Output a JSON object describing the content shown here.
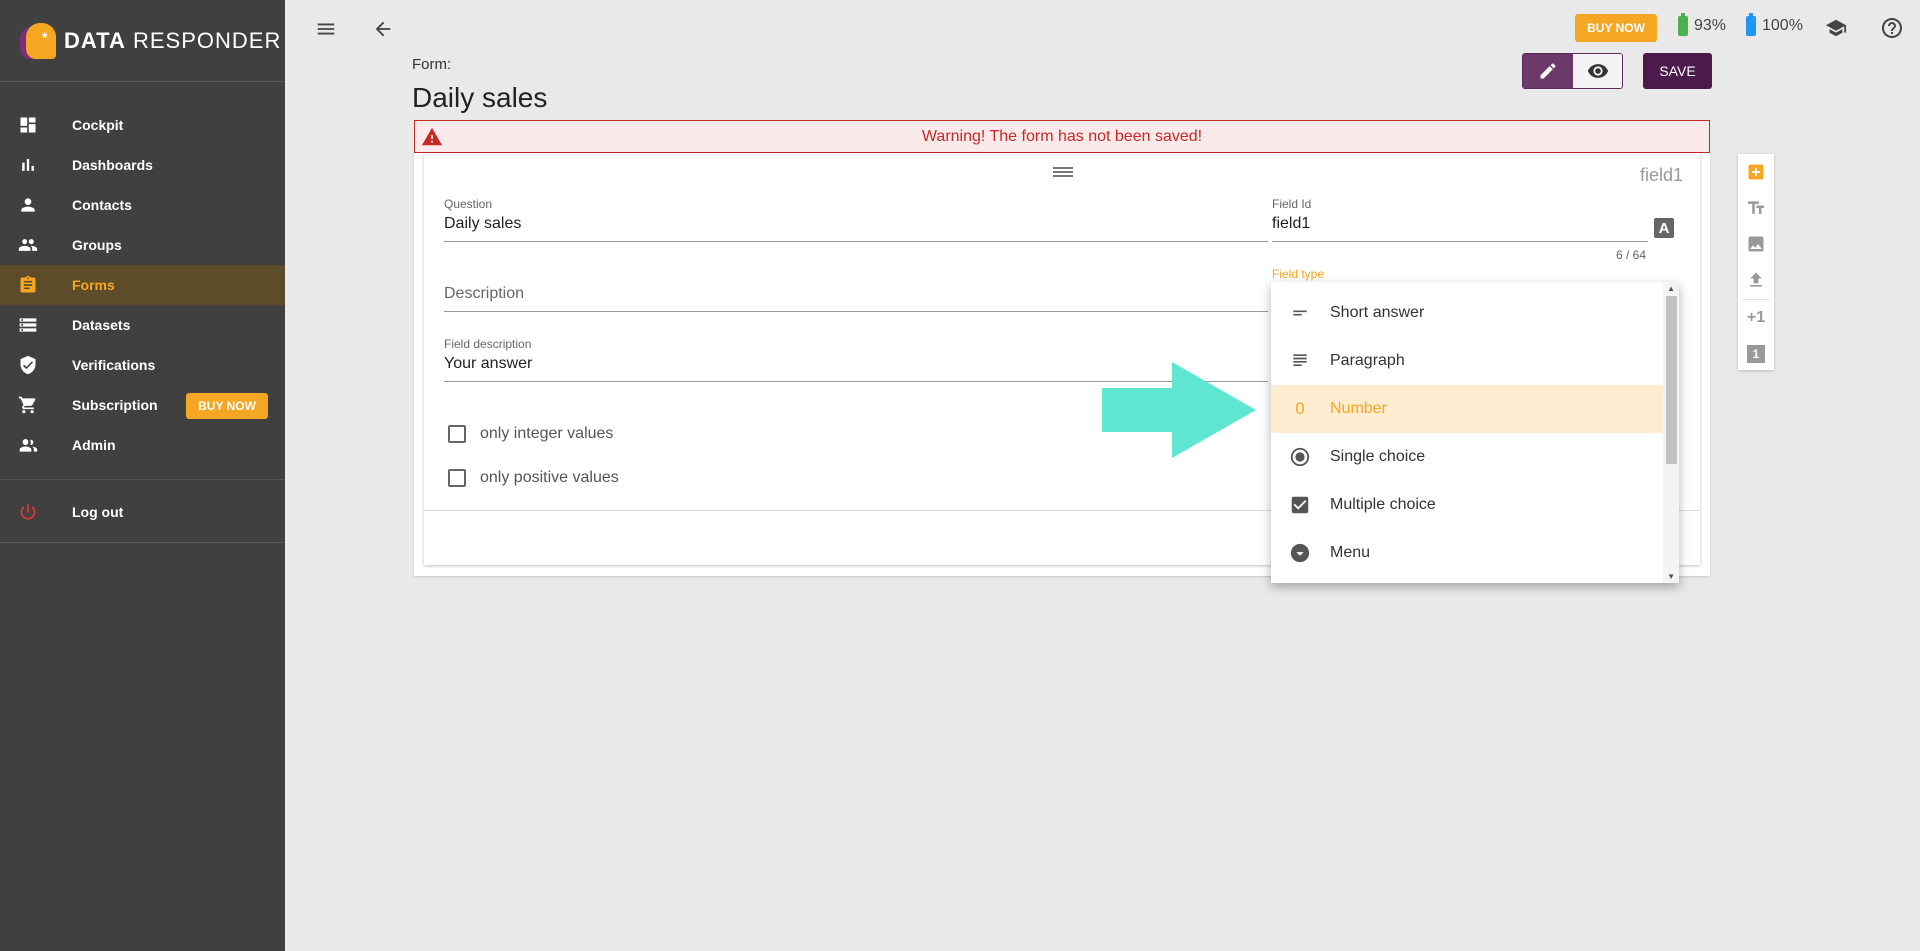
{
  "app": {
    "logo_bold": "DATA",
    "logo_rest": "RESPONDER"
  },
  "sidebar": {
    "items": [
      {
        "label": "Cockpit",
        "icon": "dashboard-icon"
      },
      {
        "label": "Dashboards",
        "icon": "bar-chart-icon"
      },
      {
        "label": "Contacts",
        "icon": "person-icon"
      },
      {
        "label": "Groups",
        "icon": "people-icon"
      },
      {
        "label": "Forms",
        "icon": "clipboard-icon",
        "active": true
      },
      {
        "label": "Datasets",
        "icon": "list-icon"
      },
      {
        "label": "Verifications",
        "icon": "shield-check-icon"
      },
      {
        "label": "Subscription",
        "icon": "cart-icon"
      },
      {
        "label": "Admin",
        "icon": "admin-people-icon"
      }
    ],
    "buy_now": "BUY NOW",
    "logout": "Log out"
  },
  "topbar": {
    "buy_now": "BUY NOW",
    "battery_green": "93%",
    "battery_blue": "100%"
  },
  "form": {
    "label": "Form:",
    "title": "Daily sales",
    "save": "SAVE",
    "warning": "Warning! The form has not been saved!"
  },
  "field": {
    "tag": "field1",
    "question_label": "Question",
    "question_value": "Daily sales",
    "field_id_label": "Field Id",
    "field_id_value": "field1",
    "counter": "6 / 64",
    "description_placeholder": "Description",
    "field_desc_label": "Field description",
    "field_desc_value": "Your answer",
    "field_type_label": "Field type",
    "check_integer": "only integer values",
    "check_positive": "only positive values"
  },
  "dropdown": {
    "options": [
      {
        "label": "Short answer",
        "icon": "short-text-icon"
      },
      {
        "label": "Paragraph",
        "icon": "paragraph-icon"
      },
      {
        "label": "Number",
        "icon": "number-icon",
        "glyph": "0",
        "selected": true
      },
      {
        "label": "Single choice",
        "icon": "radio-icon"
      },
      {
        "label": "Multiple choice",
        "icon": "checkbox-icon"
      },
      {
        "label": "Menu",
        "icon": "dropdown-circle-icon"
      }
    ]
  },
  "right_toolbar": {
    "plus_one": "+1",
    "one": "1"
  },
  "colors": {
    "accent": "#f5a623",
    "sidebar": "#404040",
    "brand_purple": "#4d1a4d",
    "warning": "#c62828",
    "arrow": "#5ee6d3"
  }
}
